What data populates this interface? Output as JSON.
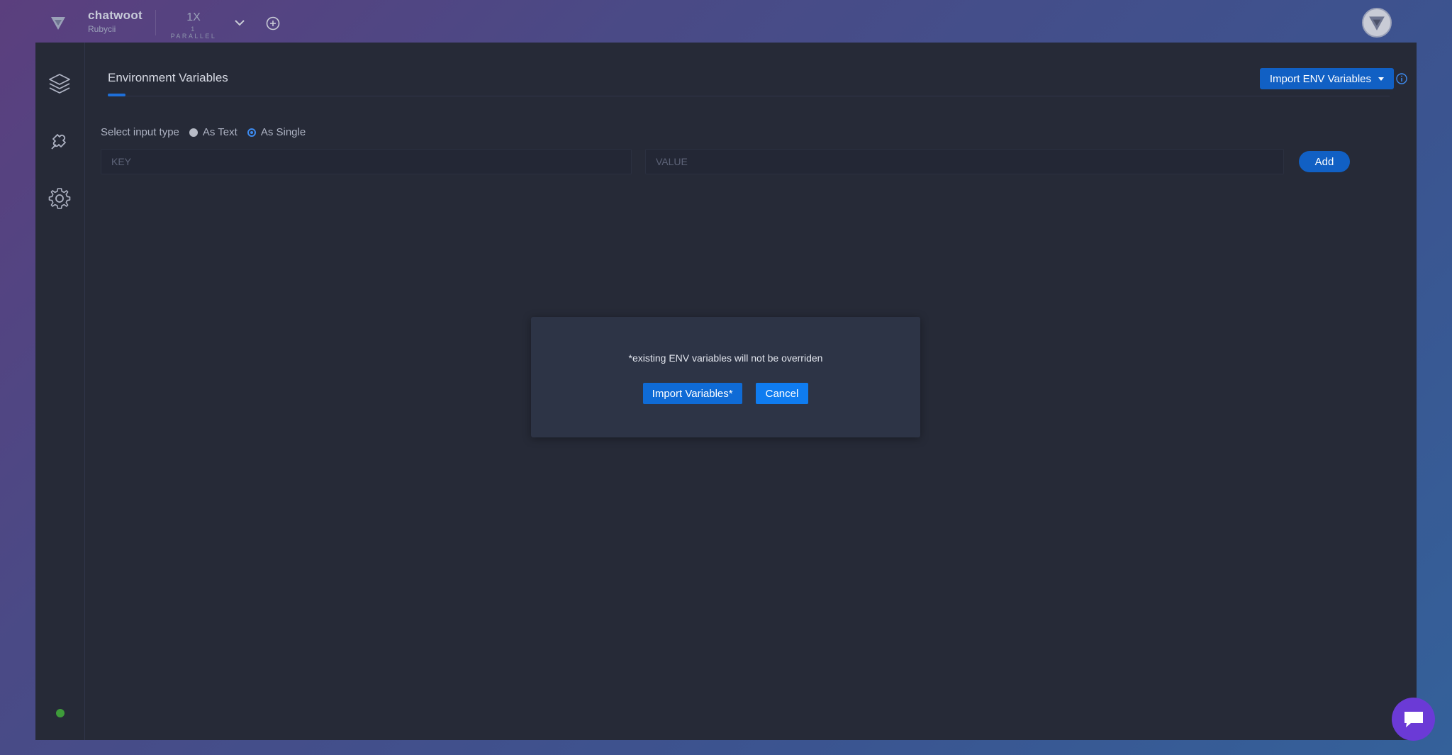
{
  "topbar": {
    "project_name": "chatwoot",
    "project_sub": "Rubycii",
    "parallel_value": "1X",
    "parallel_label": "1 PARALLEL"
  },
  "tabs": {
    "active": "Environment Variables"
  },
  "header": {
    "import_env_label": "Import ENV Variables"
  },
  "form": {
    "input_type_label": "Select input type",
    "option_text": "As Text",
    "option_single": "As Single",
    "selected": "As Single",
    "key_placeholder": "KEY",
    "value_placeholder": "VALUE",
    "add_label": "Add"
  },
  "modal": {
    "message": "*existing ENV variables will not be overriden",
    "import_label": "Import Variables*",
    "cancel_label": "Cancel"
  },
  "sidebar": {
    "items": [
      {
        "icon": "layers-icon"
      },
      {
        "icon": "puzzle-icon"
      },
      {
        "icon": "gear-icon"
      }
    ],
    "status": "online"
  },
  "colors": {
    "accent": "#1160c4",
    "panel": "#262a37",
    "chat": "#6b3ad6",
    "status": "#3e9b3a"
  }
}
